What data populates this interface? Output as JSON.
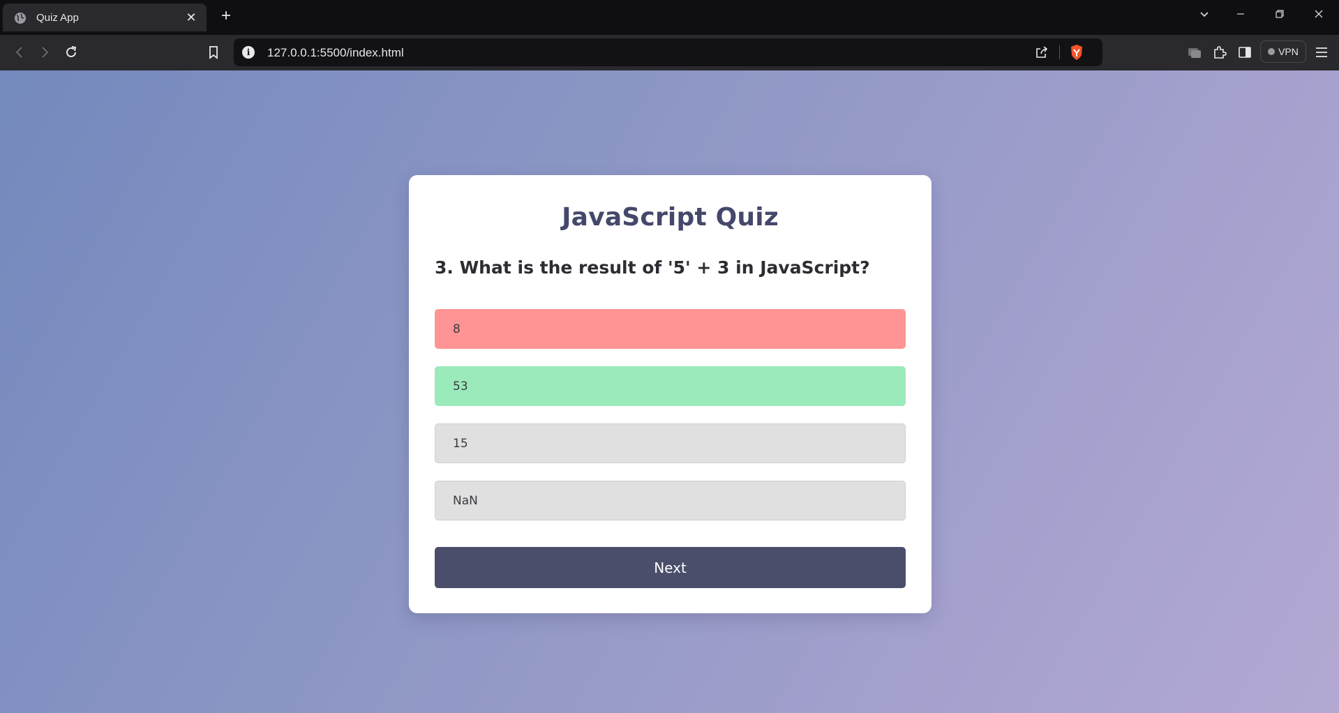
{
  "browser": {
    "tab": {
      "title": "Quiz App",
      "close_glyph": "✕",
      "icon": "globe-icon"
    },
    "new_tab_glyph": "+",
    "address": {
      "url": "127.0.0.1:5500/index.html"
    },
    "vpn_label": "VPN",
    "window_controls": {
      "menu": "⌄",
      "minimize": "—",
      "restore": "❐",
      "close": "✕"
    }
  },
  "quiz": {
    "title": "JavaScript Quiz",
    "question": "3. What is the result of '5' + 3 in JavaScript?",
    "options": [
      {
        "label": "8",
        "state": "wrong"
      },
      {
        "label": "53",
        "state": "correct"
      },
      {
        "label": "15",
        "state": "neutral"
      },
      {
        "label": "NaN",
        "state": "neutral"
      }
    ],
    "next_label": "Next"
  },
  "colors": {
    "wrong": "#ff9494",
    "correct": "#9beabb",
    "neutral": "#e0e0e0",
    "button": "#4a4e6b",
    "title": "#44486a"
  }
}
